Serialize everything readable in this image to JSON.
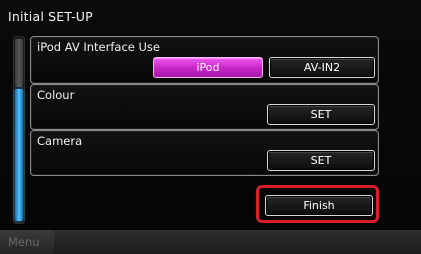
{
  "screen": {
    "title": "Initial SET-UP"
  },
  "settings": {
    "ipod_interface": {
      "label": "iPod AV Interface Use",
      "options": [
        "iPod",
        "AV-IN2"
      ],
      "selected": "iPod"
    },
    "colour": {
      "label": "Colour",
      "button_label": "SET"
    },
    "camera": {
      "label": "Camera",
      "button_label": "SET"
    }
  },
  "finish_button": {
    "label": "Finish"
  },
  "bottom_bar": {
    "menu_label": "Menu"
  },
  "colors": {
    "accent_active": "#c524c6",
    "scroll_thumb": "#4ec0ff",
    "highlight_border": "#d62028"
  }
}
